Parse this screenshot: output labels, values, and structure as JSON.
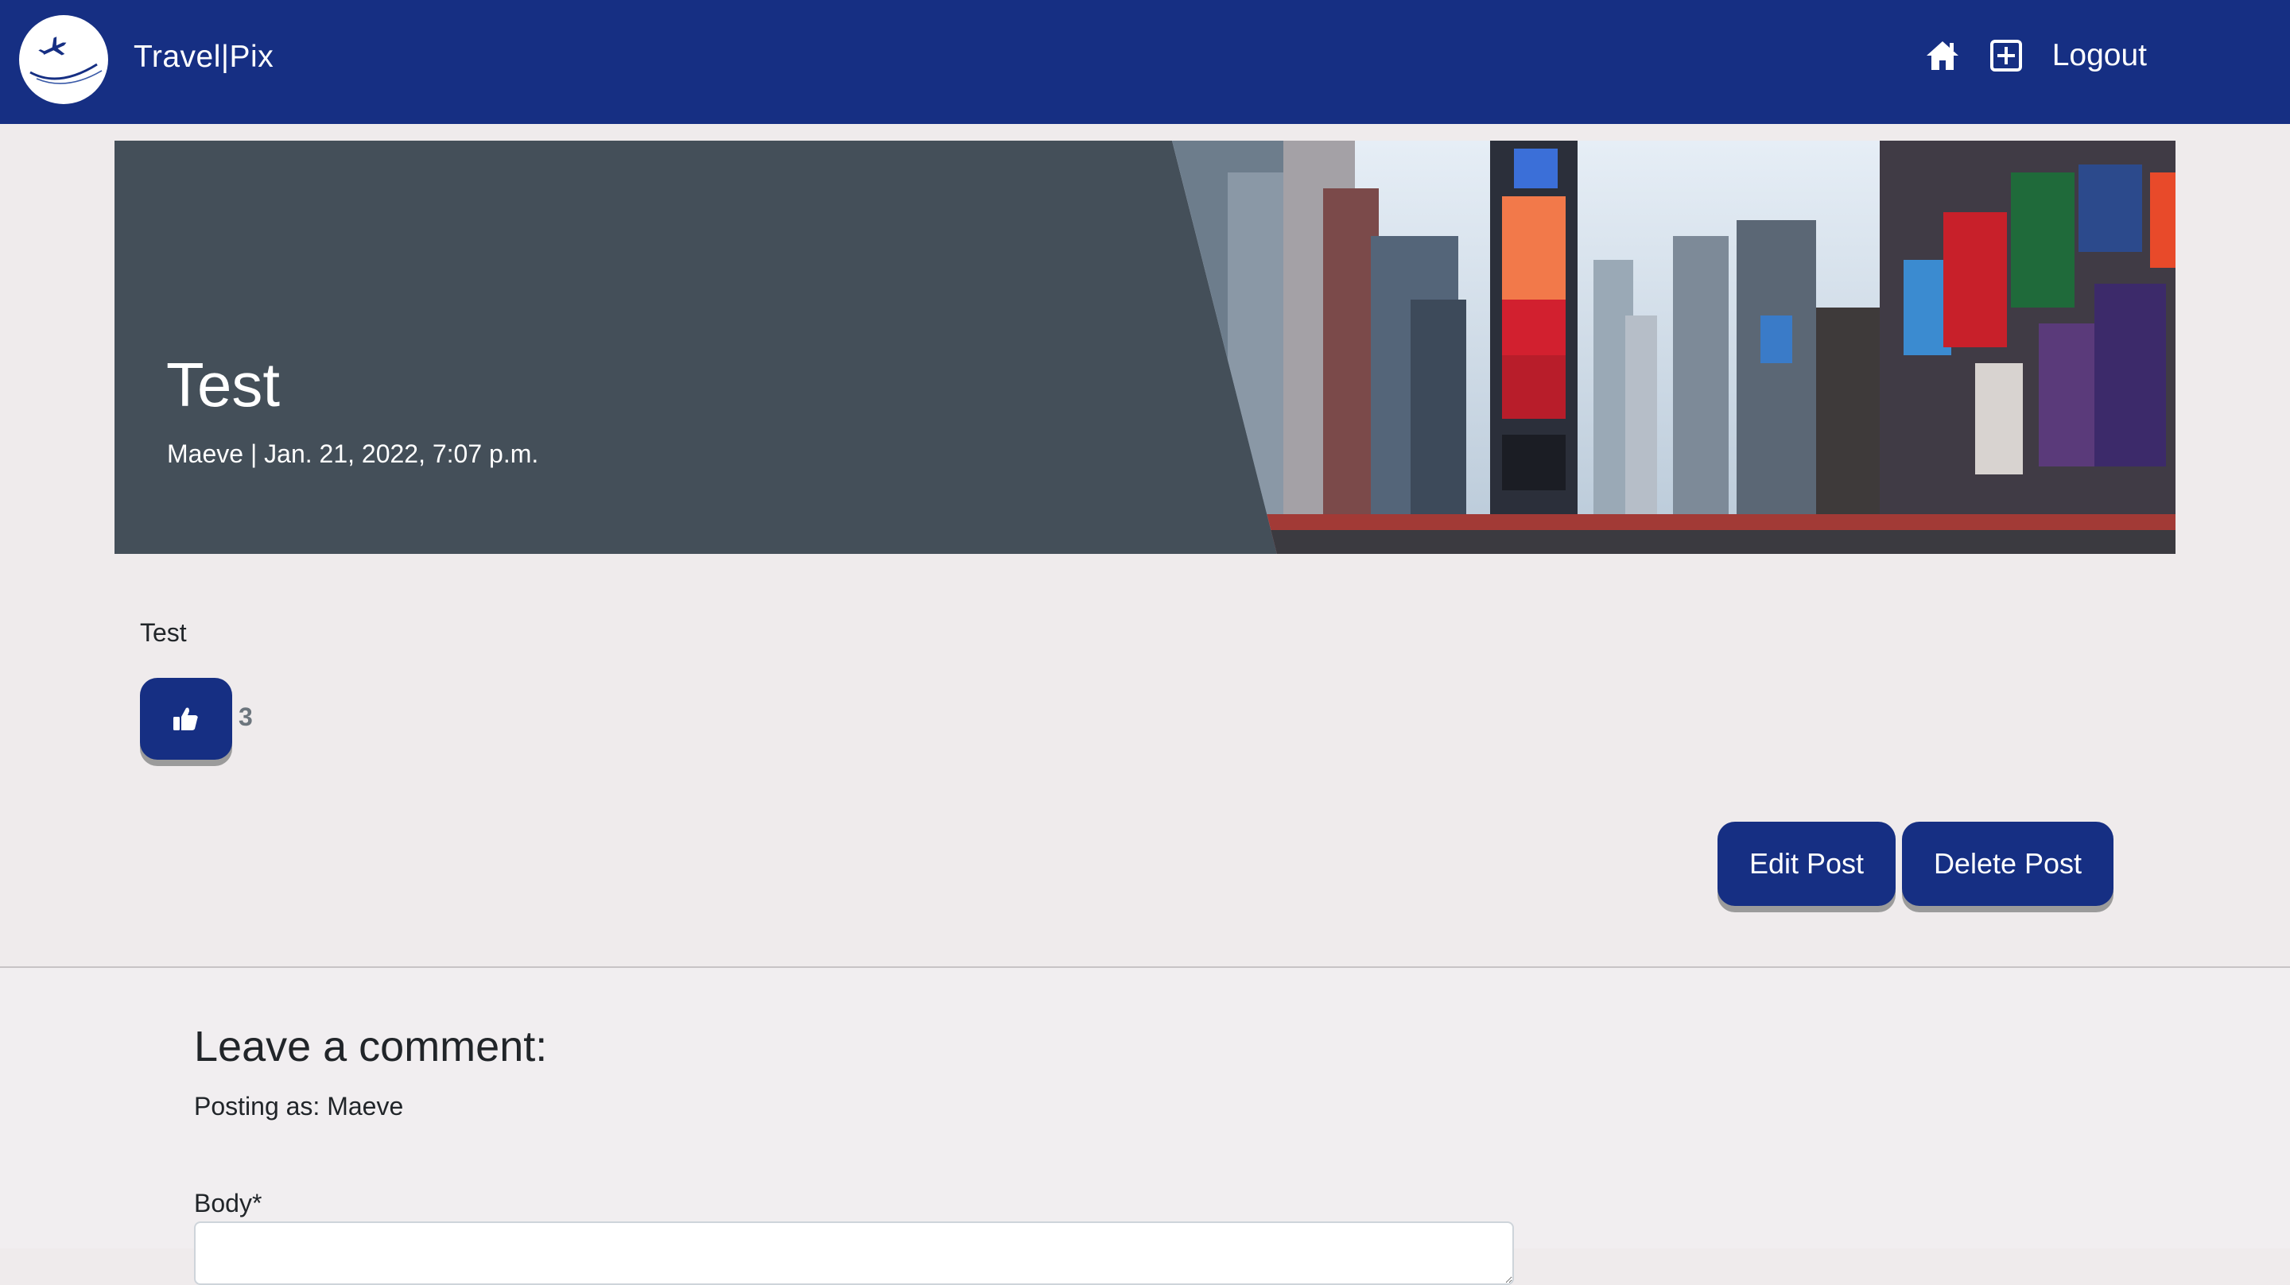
{
  "navbar": {
    "brand": "Travel|Pix",
    "logout_label": "Logout",
    "icons": [
      "home-icon",
      "add-post-icon"
    ],
    "color": "#162f83"
  },
  "post": {
    "title": "Test",
    "meta": "Maeve | Jan. 21, 2022, 7:07 p.m.",
    "content": "Test",
    "like_count": "3",
    "edit_label": "Edit Post",
    "delete_label": "Delete Post"
  },
  "comment_form": {
    "heading": "Leave a comment:",
    "posting_as": "Posting as: Maeve",
    "body_label": "Body*",
    "body_value": ""
  }
}
